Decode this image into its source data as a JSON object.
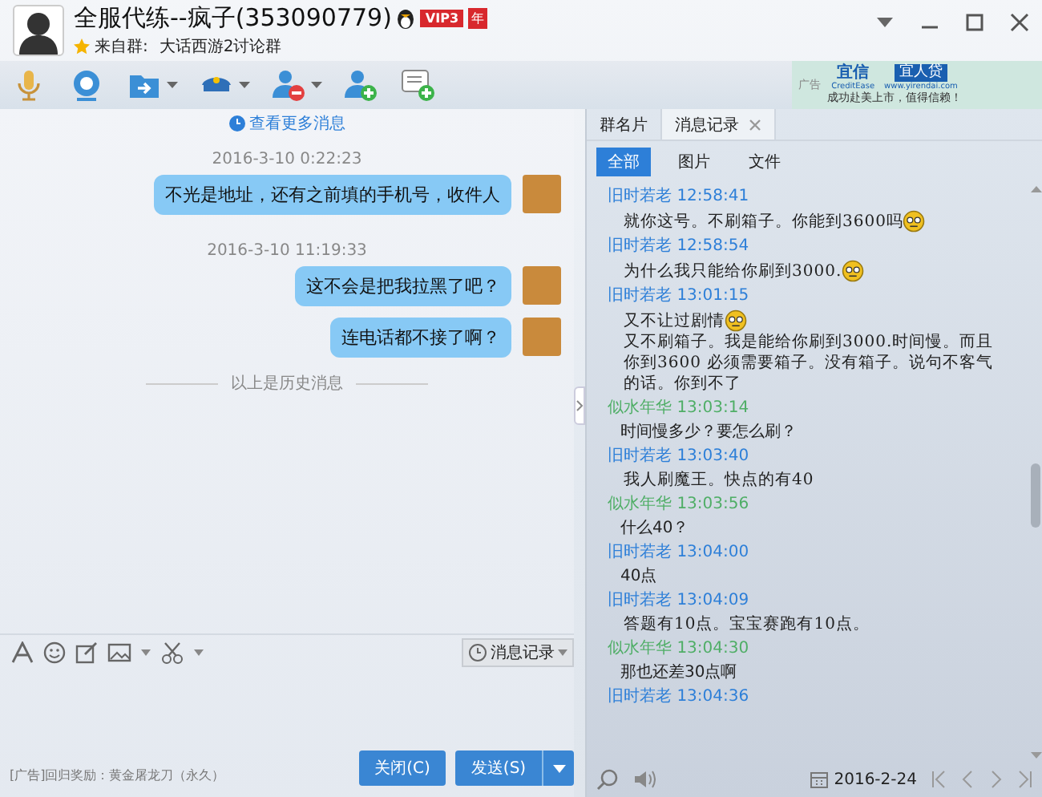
{
  "window": {
    "title": "全服代练--疯子(353090779)",
    "vip": "VIP3",
    "vip_year": "年",
    "source_label": "来自群:",
    "source_group": "大话西游2讨论群"
  },
  "ad": {
    "label": "广告",
    "brand": "宜信",
    "brand_sub": "CreditEase",
    "product": "宜人贷",
    "url": "www.yirendai.com",
    "slogan": "成功赴美上市，值得信赖！"
  },
  "chat": {
    "more_link": "查看更多消息",
    "items": [
      {
        "kind": "time",
        "text": "2016-3-10 0:22:23"
      },
      {
        "kind": "bubble",
        "text": "不光是地址，还有之前填的手机号，收件人"
      },
      {
        "kind": "time",
        "text": "2016-3-10 11:19:33"
      },
      {
        "kind": "bubble",
        "text": "这不会是把我拉黑了吧？"
      },
      {
        "kind": "bubble",
        "text": "连电话都不接了啊？"
      },
      {
        "kind": "divider",
        "text": "以上是历史消息"
      }
    ]
  },
  "input_toolbar": {
    "history_button": "消息记录"
  },
  "footer": {
    "ad_text": "[广告]回归奖励：黄金屠龙刀（永久）",
    "close_button": "关闭(C)",
    "send_button": "发送(S)"
  },
  "side": {
    "tabs": [
      {
        "label": "群名片",
        "selected": false
      },
      {
        "label": "消息记录",
        "selected": true
      }
    ],
    "filters": [
      {
        "label": "全部",
        "selected": true
      },
      {
        "label": "图片",
        "selected": false
      },
      {
        "label": "文件",
        "selected": false
      }
    ],
    "log": [
      {
        "sender": "旧时若老",
        "time": "12:58:41",
        "color": "#2d7fd8",
        "kind": "hand",
        "segments": [
          {
            "kind": "text",
            "text": "就你这号。不刷箱子。你能到3600吗"
          },
          {
            "kind": "emoticon"
          }
        ]
      },
      {
        "sender": "旧时若老",
        "time": "12:58:54",
        "color": "#2d7fd8",
        "kind": "hand",
        "segments": [
          {
            "kind": "text",
            "text": "为什么我只能给你刷到3000."
          },
          {
            "kind": "emoticon"
          }
        ]
      },
      {
        "sender": "旧时若老",
        "time": "13:01:15",
        "color": "#2d7fd8",
        "kind": "hand",
        "segments": [
          {
            "kind": "text",
            "text": "又不让过剧情"
          },
          {
            "kind": "emoticon"
          },
          {
            "kind": "text",
            "text": "又不刷箱子。我是能给你刷到3000.时间慢。而且你到3600 必须需要箱子。没有箱子。说句不客气的话。你到不了"
          }
        ]
      },
      {
        "sender": "似水年华",
        "time": "13:03:14",
        "color": "#4fae66",
        "kind": "plain",
        "segments": [
          {
            "kind": "text",
            "text": "时间慢多少？要怎么刷？"
          }
        ]
      },
      {
        "sender": "旧时若老",
        "time": "13:03:40",
        "color": "#2d7fd8",
        "kind": "hand",
        "segments": [
          {
            "kind": "text",
            "text": "我人刷魔王。快点的有40"
          }
        ]
      },
      {
        "sender": "似水年华",
        "time": "13:03:56",
        "color": "#4fae66",
        "kind": "plain",
        "segments": [
          {
            "kind": "text",
            "text": "什么40？"
          }
        ]
      },
      {
        "sender": "旧时若老",
        "time": "13:04:00",
        "color": "#2d7fd8",
        "kind": "plain",
        "segments": [
          {
            "kind": "text",
            "text": "40点"
          }
        ]
      },
      {
        "sender": "旧时若老",
        "time": "13:04:09",
        "color": "#2d7fd8",
        "kind": "hand",
        "segments": [
          {
            "kind": "text",
            "text": "答题有10点。宝宝赛跑有10点。"
          }
        ]
      },
      {
        "sender": "似水年华",
        "time": "13:04:30",
        "color": "#4fae66",
        "kind": "plain",
        "segments": [
          {
            "kind": "text",
            "text": "那也还差30点啊"
          }
        ]
      },
      {
        "sender": "旧时若老",
        "time": "13:04:36",
        "color": "#2d7fd8"
      }
    ],
    "date": "2016-2-24"
  }
}
